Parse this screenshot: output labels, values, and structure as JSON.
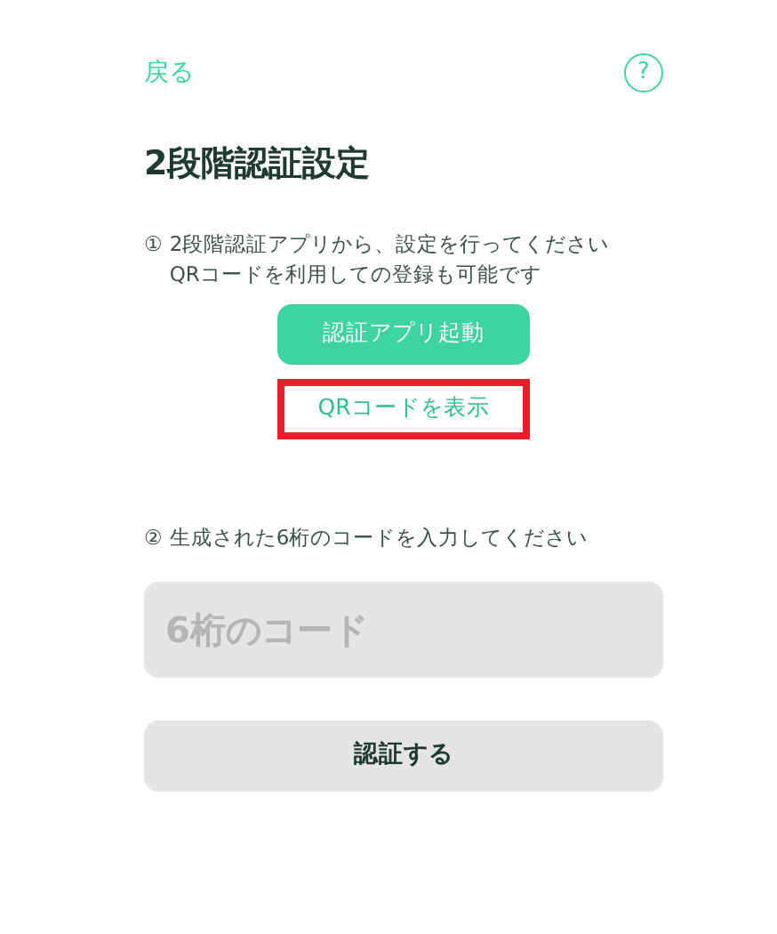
{
  "header": {
    "back_link": "戻る",
    "help_icon": "?"
  },
  "title": "2段階認証設定",
  "step_1": {
    "marker": "①",
    "lines": [
      "2段階認証アプリから、設定を行ってください",
      "QRコードを利用しての登録も可能です"
    ]
  },
  "buttons": [
    {
      "label": "認証アプリ起動",
      "kind": "primary",
      "highlighted": false
    },
    {
      "label": "QRコードを表示",
      "kind": "link",
      "highlighted": true
    }
  ],
  "step_2": {
    "marker": "②",
    "text": "生成された6桁のコードを入力してください"
  },
  "code_field": {
    "placeholder": "6桁のコード"
  },
  "submit_button": {
    "label": "認証する"
  }
}
